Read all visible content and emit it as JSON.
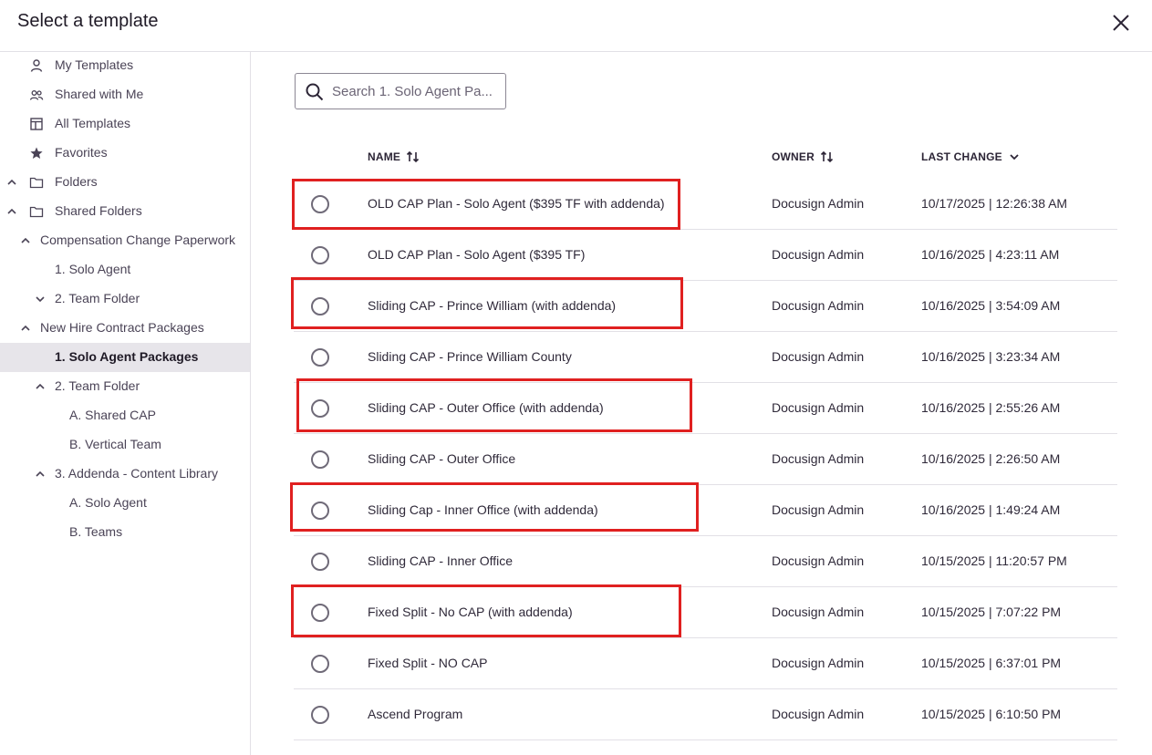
{
  "header": {
    "title": "Select a template"
  },
  "sidebar": {
    "items": [
      {
        "label": "My Templates"
      },
      {
        "label": "Shared with Me"
      },
      {
        "label": "All Templates"
      },
      {
        "label": "Favorites"
      },
      {
        "label": "Folders"
      },
      {
        "label": "Shared Folders"
      },
      {
        "label": "Compensation Change Paperwork"
      },
      {
        "label": "1. Solo Agent"
      },
      {
        "label": "2. Team Folder"
      },
      {
        "label": "New Hire Contract Packages"
      },
      {
        "label": "1. Solo Agent Packages"
      },
      {
        "label": "2. Team Folder"
      },
      {
        "label": "A. Shared CAP"
      },
      {
        "label": "B. Vertical Team"
      },
      {
        "label": "3. Addenda - Content Library"
      },
      {
        "label": "A. Solo Agent"
      },
      {
        "label": "B. Teams"
      }
    ]
  },
  "search": {
    "placeholder": "Search 1. Solo Agent Pa..."
  },
  "table": {
    "headers": {
      "name": "NAME",
      "owner": "OWNER",
      "last_change": "LAST CHANGE"
    },
    "rows": [
      {
        "name": "OLD CAP Plan - Solo Agent ($395 TF with addenda)",
        "owner": "Docusign Admin",
        "last_change": "10/17/2025 | 12:26:38 AM"
      },
      {
        "name": "OLD CAP Plan - Solo Agent ($395 TF)",
        "owner": "Docusign Admin",
        "last_change": "10/16/2025 | 4:23:11 AM"
      },
      {
        "name": "Sliding CAP - Prince William (with addenda)",
        "owner": "Docusign Admin",
        "last_change": "10/16/2025 | 3:54:09 AM"
      },
      {
        "name": "Sliding CAP - Prince William County",
        "owner": "Docusign Admin",
        "last_change": "10/16/2025 | 3:23:34 AM"
      },
      {
        "name": "Sliding CAP - Outer Office (with addenda)",
        "owner": "Docusign Admin",
        "last_change": "10/16/2025 | 2:55:26 AM"
      },
      {
        "name": "Sliding CAP - Outer Office",
        "owner": "Docusign Admin",
        "last_change": "10/16/2025 | 2:26:50 AM"
      },
      {
        "name": "Sliding Cap - Inner Office (with addenda)",
        "owner": "Docusign Admin",
        "last_change": "10/16/2025 | 1:49:24 AM"
      },
      {
        "name": "Sliding CAP - Inner Office",
        "owner": "Docusign Admin",
        "last_change": "10/15/2025 | 11:20:57 PM"
      },
      {
        "name": "Fixed Split - No CAP (with addenda)",
        "owner": "Docusign Admin",
        "last_change": "10/15/2025 | 7:07:22 PM"
      },
      {
        "name": "Fixed Split - NO CAP",
        "owner": "Docusign Admin",
        "last_change": "10/15/2025 | 6:37:01 PM"
      },
      {
        "name": "Ascend Program",
        "owner": "Docusign Admin",
        "last_change": "10/15/2025 | 6:10:50 PM"
      }
    ]
  },
  "colors": {
    "highlight": "#e02020",
    "selected_bg": "#e7e5ea"
  }
}
